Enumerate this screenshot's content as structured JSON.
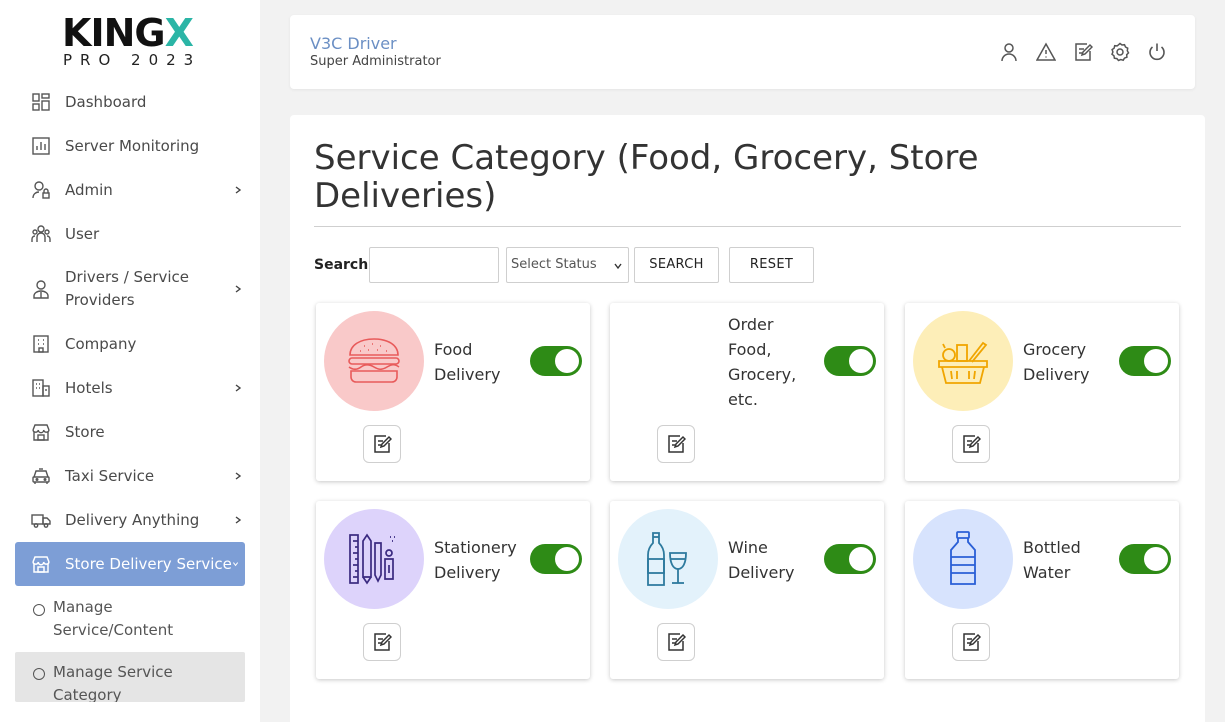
{
  "brand": {
    "name_main": "KING",
    "name_x": "X",
    "tagline": "PRO 2023"
  },
  "sidebar": {
    "items": [
      {
        "label": "Dashboard",
        "icon": "dashboard-icon"
      },
      {
        "label": "Server Monitoring",
        "icon": "chart-icon"
      },
      {
        "label": "Admin",
        "icon": "user-lock-icon",
        "has_children": true
      },
      {
        "label": "User",
        "icon": "users-icon"
      },
      {
        "label": "Drivers / Service Providers",
        "icon": "driver-icon",
        "has_children": true
      },
      {
        "label": "Company",
        "icon": "building-icon"
      },
      {
        "label": "Hotels",
        "icon": "hotel-icon",
        "has_children": true
      },
      {
        "label": "Store",
        "icon": "store-icon"
      },
      {
        "label": "Taxi Service",
        "icon": "car-icon",
        "has_children": true
      },
      {
        "label": "Delivery Anything",
        "icon": "truck-icon",
        "has_children": true
      },
      {
        "label": "Store Delivery Service",
        "icon": "store-icon",
        "active": true
      }
    ],
    "sub_items": [
      {
        "label": "Manage Service/Content"
      },
      {
        "label": "Manage Service Category",
        "selected": true
      }
    ]
  },
  "header": {
    "user_name": "V3C Driver",
    "user_role": "Super Administrator",
    "icons": [
      "user-icon",
      "alert-icon",
      "edit-icon",
      "settings-icon",
      "power-icon"
    ]
  },
  "page": {
    "title": "Service Category (Food, Grocery, Store Deliveries)",
    "search_label": "Search:",
    "search_value": "",
    "status_select": "Select Status",
    "search_button": "SEARCH",
    "reset_button": "RESET"
  },
  "categories": [
    {
      "name": "Food Delivery",
      "icon": "burger-icon",
      "bg": "#f9c9c9",
      "enabled": true
    },
    {
      "name": "Order Food, Grocery, etc.",
      "icon": "",
      "bg": "#ffffff",
      "enabled": true
    },
    {
      "name": "Grocery Delivery",
      "icon": "grocery-basket-icon",
      "bg": "#fdeeb8",
      "enabled": true
    },
    {
      "name": "Stationery Delivery",
      "icon": "stationery-icon",
      "bg": "#ddd3fb",
      "enabled": true
    },
    {
      "name": "Wine Delivery",
      "icon": "wine-icon",
      "bg": "#e3f2fb",
      "enabled": true
    },
    {
      "name": "Bottled Water",
      "icon": "water-bottle-icon",
      "bg": "#d7e3fd",
      "enabled": true
    }
  ],
  "colors": {
    "accent": "#7d9ed6",
    "toggle_on": "#2e8b16",
    "brand_x": "#2bb5a6",
    "user_name": "#6b8fc4"
  }
}
